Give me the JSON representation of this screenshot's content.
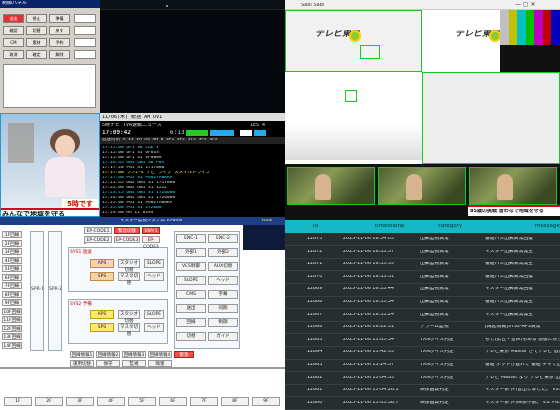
{
  "control": {
    "title": "制御パネル",
    "buttons": [
      "送出",
      "停止",
      "準備",
      "確認",
      "切替",
      "戻す",
      "CM",
      "素材",
      "予約",
      "取消",
      "確定",
      "解除"
    ]
  },
  "news": {
    "badge": "5時です",
    "caption": "みんなで地域を守る"
  },
  "tbl": {
    "head": "11/06(木) 統括 AM DV1",
    "bar1": "5時ナビ  TVA速報ニュース",
    "bar1r": "1ES 4",
    "clock": "17:09:42",
    "clock2": "6:13",
    "cols": "放送時刻 M VS VM AS AN B SP1 SP2 SF3 SF4 SFX",
    "rows": [
      "17:15:00  UF1  SB         CUE V",
      "17:15:00  UF1  S1         GF03S",
      "17:15:00  UF1  S1         VF0008",
      "17:16:45  ONI  ON1  SB    P04",
      "17:17:20  PG1       S1    1717000",
      "17:17:00  ラン2-4 ナビ ライブ スタイルドライブ",
      "17:17:00  PG1       S1    P6027A0KKA",
      "17:21:45  ONI  ON1  S1    1717000",
      "17:22:00  ONI  ON1  S1    1222",
      "17:23:15  ONI  ON1  S1    1726000",
      "17:24:00  ONI  ON1  S1    1726000",
      "17:25:00  PG1       S1    P6027A00KA",
      "17:25:00  PG1       S1    172000",
      "17:29:00  MA   L1         0194"
    ]
  },
  "app": {
    "title": "マスター監視システム  V.Panel",
    "status": "RUN",
    "sys1": "SYS1  放送",
    "sys2": "SYS2  予備",
    "left_items": [
      "1F回線",
      "2F回線",
      "3F回線",
      "4F回線",
      "5F回線",
      "6F回線",
      "7F回線",
      "8F回線",
      "9F回線",
      "10F回線",
      "11F回線",
      "12F回線",
      "13F回線",
      "14F回線"
    ],
    "spr": [
      "SPR-1",
      "SPR-2"
    ],
    "mid_top": [
      "EP-CODE1",
      "EP-CODE2",
      "EP-CODE3",
      "EP-CODE4"
    ],
    "aps": "APS",
    "sps": "SPS",
    "sub_boxes": [
      "スタジオ切替",
      "マスタ切替",
      "SLOPE",
      "ヘッド"
    ],
    "red_boxes": [
      "緊急切替ENY-1",
      "ENY-1",
      "緊急"
    ],
    "right_items": [
      "ENC-1",
      "ENC-2",
      "外部1",
      "外部2",
      "VCS制御",
      "AUX切替",
      "SLOPE",
      "ヘッド",
      "CMS",
      "字幕",
      "送出",
      "同期",
      "回線",
      "制御",
      "切替",
      "ガイド"
    ],
    "bottom_items": [
      "回線情報1",
      "回線情報2",
      "回線情報3",
      "回線情報4",
      "運用切替",
      "保守",
      "監視",
      "障害"
    ],
    "footer": [
      "1F",
      "2F",
      "3F",
      "4F",
      "5F",
      "6F",
      "7F",
      "8F",
      "9F"
    ]
  },
  "right": {
    "title": "Sabi Sabi",
    "logo": "テレビ東京",
    "caption": "85歳の挑戦 皆わなで地域を守る"
  },
  "log": {
    "headers": [
      "id",
      "timestamp",
      "category",
      "message"
    ],
    "rows": [
      [
        "12873",
        "2025-11-06 16:34:03",
        "出郵監視異常",
        "番組パス出郵異常回復"
      ],
      [
        "12872",
        "2025-11-06 16:33:57",
        "出郵監視異常",
        "マスター出郵異常発生"
      ],
      [
        "12871",
        "2025-11-06 16:33:55",
        "出郵監視異常",
        "番組パス出郵異常発生"
      ],
      [
        "12870",
        "2025-11-06 16:33:51",
        "出郵監視異常",
        "番組パス出郵異常回復"
      ],
      [
        "12869",
        "2025-11-06 16:33:44",
        "出郵監視異常",
        "マスター出郵異常回復"
      ],
      [
        "12868",
        "2025-11-06 16:33:34",
        "出郵監視異常",
        "番組パス出郵異常発生"
      ],
      [
        "12867",
        "2025-11-06 16:33:24",
        "出郵監視異常",
        "マスター出郵異常発生"
      ],
      [
        "12866",
        "2025-11-06 16:22:31",
        "アラーム監視",
        "[再起情報]SYS2-APS異常"
      ],
      [
        "12865",
        "2025-11-06 15:05:34",
        "TXNボイス判定",
        "もし(広告・音声)もある 前後に戻ります"
      ],
      [
        "12864",
        "2025-11-06 15:42:53",
        "TXNボイス判定",
        "テレビ東京 Mastar さてテレビ 放送は 元気"
      ],
      [
        "12863",
        "2025-11-06 15:24:57",
        "TXNボイス判定",
        "番組 ポッドが遅れて 番組 チャで出典"
      ],
      [
        "12862",
        "2025-11-06 15:04:33",
        "TXNボイス判定",
        "テレビ Master より テレビ東京 出発"
      ],
      [
        "12861",
        "2025-11-06 15:04:28.1",
        "映像画質判定",
        "マスター系 (P)音出しました。 VS: PG1"
      ],
      [
        "12860",
        "2025-11-06 15:03:38.7",
        "映像画質判定",
        "マスター系 (P)映像不良。 VS: PG1"
      ]
    ]
  },
  "colors": {
    "accent_cyan": "#16b8c8",
    "frame_green": "#1c2",
    "frame_blue": "#29d",
    "alarm_red": "#e85048"
  }
}
